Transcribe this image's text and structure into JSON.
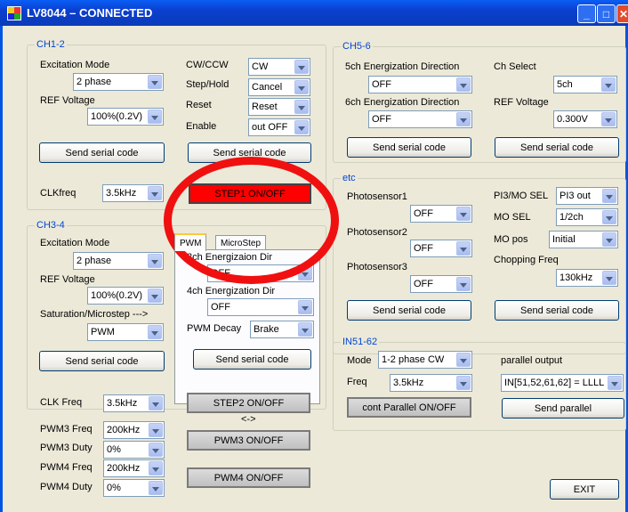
{
  "window": {
    "title": "LV8044 – CONNECTED",
    "min": "_",
    "max": "□",
    "close": "✕"
  },
  "ch12": {
    "group": "CH1-2",
    "excitation_label": "Excitation Mode",
    "excitation": "2 phase",
    "ref_label": "REF Voltage",
    "ref": "100%(0.2V)",
    "cwccw_label": "CW/CCW",
    "cwccw": "CW",
    "stephold_label": "Step/Hold",
    "stephold": "Cancel",
    "reset_label": "Reset",
    "reset": "Reset",
    "enable_label": "Enable",
    "enable": "out OFF",
    "send1": "Send serial code",
    "send2": "Send serial code",
    "clk_label": "CLKfreq",
    "clk": "3.5kHz",
    "step1": "STEP1 ON/OFF"
  },
  "ch34": {
    "group": "CH3-4",
    "excitation_label": "Excitation Mode",
    "excitation": "2 phase",
    "ref_label": "REF Voltage",
    "ref": "100%(0.2V)",
    "sat_label": "Saturation/Microstep --->",
    "sat": "PWM",
    "send": "Send serial code",
    "tab_pwm": "PWM",
    "tab_micro": "MicroStep",
    "dir3_label": "3ch Energizaion Dir",
    "dir3": "OFF",
    "dir4_label": "4ch Energization Dir",
    "dir4": "OFF",
    "decay_label": "PWM Decay",
    "decay": "Brake",
    "tab_send": "Send serial code"
  },
  "bottom": {
    "clk_label": "CLK Freq",
    "clk": "3.5kHz",
    "pwm3f_label": "PWM3 Freq",
    "pwm3f": "200kHz",
    "pwm3d_label": "PWM3 Duty",
    "pwm3d": "0%",
    "pwm4f_label": "PWM4 Freq",
    "pwm4f": "200kHz",
    "pwm4d_label": "PWM4 Duty",
    "pwm4d": "0%",
    "step2": "STEP2 ON/OFF",
    "swap": "<->",
    "pwm3": "PWM3 ON/OFF",
    "pwm4": "PWM4 ON/OFF"
  },
  "ch56": {
    "group": "CH5-6",
    "dir5_label": "5ch Energization Direction",
    "dir5": "OFF",
    "dir6_label": "6ch Energization Direction",
    "dir6": "OFF",
    "chsel_label": "Ch Select",
    "chsel": "5ch",
    "ref_label": "REF Voltage",
    "ref": "0.300V",
    "send1": "Send serial code",
    "send2": "Send serial code"
  },
  "etc": {
    "group": "etc",
    "ps1_label": "Photosensor1",
    "ps1": "OFF",
    "ps2_label": "Photosensor2",
    "ps2": "OFF",
    "ps3_label": "Photosensor3",
    "ps3": "OFF",
    "pi3_label": "PI3/MO SEL",
    "pi3": "PI3 out",
    "mosel_label": "MO SEL",
    "mosel": "1/2ch",
    "mopos_label": "MO pos",
    "mopos": "Initial",
    "chop_label": "Chopping Freq",
    "chop": "130kHz",
    "send1": "Send serial code",
    "send2": "Send serial code"
  },
  "in51": {
    "group": "IN51-62",
    "mode_label": "Mode",
    "mode": "1-2 phase CW",
    "freq_label": "Freq",
    "freq": "3.5kHz",
    "par_label": "parallel output",
    "par": "IN[51,52,61,62] = LLLL",
    "cont": "cont Parallel ON/OFF",
    "send": "Send parallel"
  },
  "exit": "EXIT",
  "colors": {
    "accent": "#0046d5",
    "titlebar": "#0a3bb9",
    "annotation": "#f01010",
    "step_active": "#ff0000"
  }
}
